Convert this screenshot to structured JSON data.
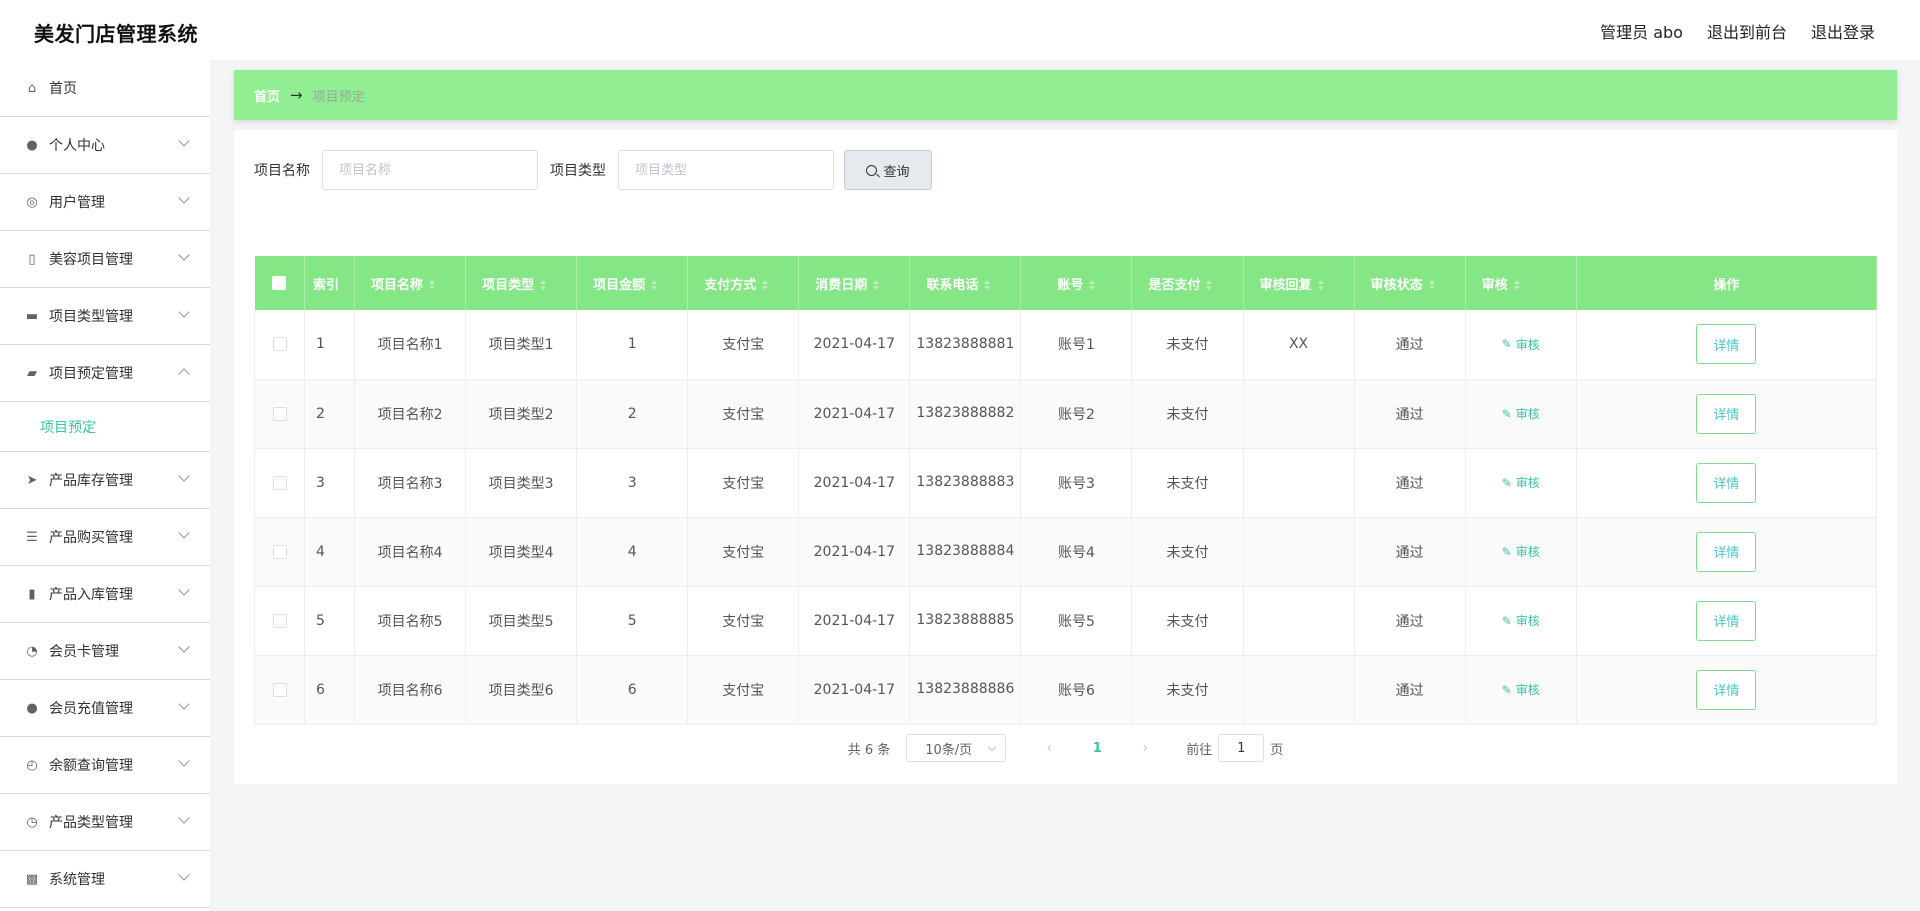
{
  "header": {
    "title": "美发门店管理系统",
    "admin_label": "管理员 abo",
    "to_front": "退出到前台",
    "logout": "退出登录"
  },
  "sidebar": {
    "items": [
      {
        "label": "首页",
        "icon": "home-icon",
        "has_children": false
      },
      {
        "label": "个人中心",
        "icon": "user-icon",
        "has_children": true
      },
      {
        "label": "用户管理",
        "icon": "lifebuoy-icon",
        "has_children": true
      },
      {
        "label": "美容项目管理",
        "icon": "microphone-icon",
        "has_children": true
      },
      {
        "label": "项目类型管理",
        "icon": "chat-icon",
        "has_children": true
      },
      {
        "label": "项目预定管理",
        "icon": "thumb-icon",
        "has_children": true,
        "expanded": true
      },
      {
        "label": "产品库存管理",
        "icon": "send-icon",
        "has_children": true
      },
      {
        "label": "产品购买管理",
        "icon": "list-icon",
        "has_children": true
      },
      {
        "label": "产品入库管理",
        "icon": "bar-icon",
        "has_children": true
      },
      {
        "label": "会员卡管理",
        "icon": "compass-icon",
        "has_children": true
      },
      {
        "label": "会员充值管理",
        "icon": "user-icon",
        "has_children": true
      },
      {
        "label": "余额查询管理",
        "icon": "gauge-icon",
        "has_children": true
      },
      {
        "label": "产品类型管理",
        "icon": "clock-icon",
        "has_children": true
      },
      {
        "label": "系统管理",
        "icon": "ticket-icon",
        "has_children": true
      }
    ],
    "submenu": {
      "label": "项目预定"
    }
  },
  "breadcrumb": {
    "home": "首页",
    "separator": "→",
    "current": "项目预定"
  },
  "search": {
    "name_label": "项目名称",
    "name_placeholder": "项目名称",
    "type_label": "项目类型",
    "type_placeholder": "项目类型",
    "query_button": "查询"
  },
  "table": {
    "columns": [
      "索引",
      "项目名称",
      "项目类型",
      "项目金额",
      "支付方式",
      "消费日期",
      "联系电话",
      "账号",
      "是否支付",
      "审核回复",
      "审核状态",
      "审核",
      "操作"
    ],
    "audit_label": "审核",
    "detail_label": "详情",
    "rows": [
      {
        "index": "1",
        "name": "项目名称1",
        "type": "项目类型1",
        "amount": "1",
        "pay_method": "支付宝",
        "date": "2021-04-17",
        "phone": "13823888881",
        "account": "账号1",
        "paid": "未支付",
        "reply": "XX",
        "status": "通过"
      },
      {
        "index": "2",
        "name": "项目名称2",
        "type": "项目类型2",
        "amount": "2",
        "pay_method": "支付宝",
        "date": "2021-04-17",
        "phone": "13823888882",
        "account": "账号2",
        "paid": "未支付",
        "reply": "",
        "status": "通过"
      },
      {
        "index": "3",
        "name": "项目名称3",
        "type": "项目类型3",
        "amount": "3",
        "pay_method": "支付宝",
        "date": "2021-04-17",
        "phone": "13823888883",
        "account": "账号3",
        "paid": "未支付",
        "reply": "",
        "status": "通过"
      },
      {
        "index": "4",
        "name": "项目名称4",
        "type": "项目类型4",
        "amount": "4",
        "pay_method": "支付宝",
        "date": "2021-04-17",
        "phone": "13823888884",
        "account": "账号4",
        "paid": "未支付",
        "reply": "",
        "status": "通过"
      },
      {
        "index": "5",
        "name": "项目名称5",
        "type": "项目类型5",
        "amount": "5",
        "pay_method": "支付宝",
        "date": "2021-04-17",
        "phone": "13823888885",
        "account": "账号5",
        "paid": "未支付",
        "reply": "",
        "status": "通过"
      },
      {
        "index": "6",
        "name": "项目名称6",
        "type": "项目类型6",
        "amount": "6",
        "pay_method": "支付宝",
        "date": "2021-04-17",
        "phone": "13823888886",
        "account": "账号6",
        "paid": "未支付",
        "reply": "",
        "status": "通过"
      }
    ]
  },
  "pagination": {
    "total": "共 6 条",
    "page_size": "10条/页",
    "current_page": "1",
    "goto_prefix": "前往",
    "goto_value": "1",
    "goto_suffix": "页"
  },
  "colors": {
    "accent_green": "#92ee92",
    "header_green": "#84e684",
    "link_teal": "#35c7a3"
  }
}
